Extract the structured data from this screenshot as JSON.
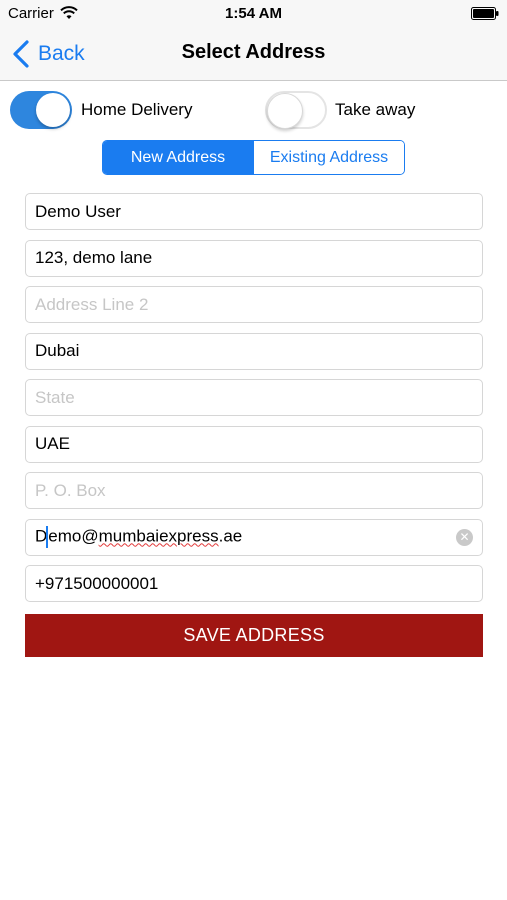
{
  "status_bar": {
    "carrier": "Carrier",
    "time": "1:54 AM"
  },
  "nav": {
    "back_label": "Back",
    "title": "Select Address"
  },
  "delivery_options": {
    "home_delivery": {
      "label": "Home Delivery",
      "on": true
    },
    "take_away": {
      "label": "Take away",
      "on": false
    }
  },
  "segments": {
    "new": "New Address",
    "existing": "Existing Address",
    "selected": "New Address"
  },
  "fields": {
    "name": {
      "value": "Demo User",
      "placeholder": ""
    },
    "address1": {
      "value": "123, demo lane",
      "placeholder": ""
    },
    "address2": {
      "value": "",
      "placeholder": "Address Line 2"
    },
    "city": {
      "value": "Dubai",
      "placeholder": ""
    },
    "state": {
      "value": "",
      "placeholder": "State"
    },
    "country": {
      "value": "UAE",
      "placeholder": ""
    },
    "pobox": {
      "value": "",
      "placeholder": "P. O. Box"
    },
    "email": {
      "value_start": "D",
      "value_rest_a": "emo@",
      "value_misspelled": "mumbaiexpress",
      "value_rest_b": ".ae"
    },
    "phone": {
      "value": "+971500000001",
      "placeholder": ""
    }
  },
  "save_button": {
    "label": "SAVE ADDRESS"
  },
  "colors": {
    "accent": "#1a7cf0",
    "switch_on": "#2e86de",
    "save_bg": "#a01612"
  }
}
